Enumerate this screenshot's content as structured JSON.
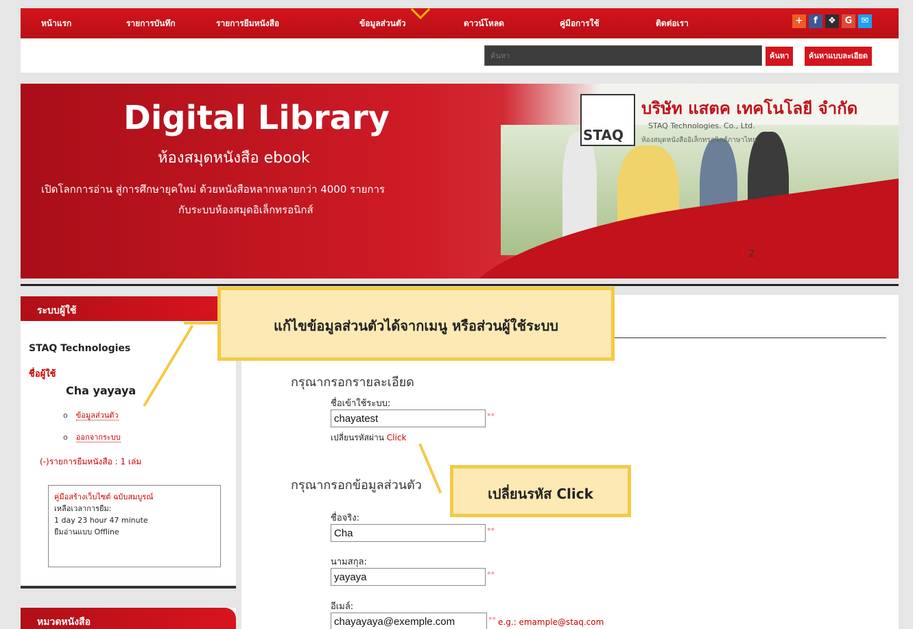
{
  "nav": {
    "items": [
      "หน้าแรก",
      "รายการบันทึก",
      "รายการยืมหนังสือ",
      "ข้อมูลส่วนตัว",
      "ดาวน์โหลด",
      "คู่มือการใช้",
      "ติดต่อเรา"
    ],
    "social_icons": [
      {
        "name": "plus-icon",
        "glyph": "+",
        "color": "#f05a28"
      },
      {
        "name": "facebook-icon",
        "glyph": "f",
        "color": "#3b5998"
      },
      {
        "name": "myspace-icon",
        "glyph": "❖",
        "color": "#2e2e2e"
      },
      {
        "name": "google-icon",
        "glyph": "G",
        "color": "#dd4b39"
      },
      {
        "name": "twitter-icon",
        "glyph": "✉",
        "color": "#1da1f2"
      }
    ]
  },
  "search": {
    "placeholder": "ค้นหา",
    "button": "ค้นหา",
    "advanced_button": "ค้นหาแบบละเอียด"
  },
  "banner": {
    "title": "Digital Library",
    "subtitle": "ห้องสมุดหนังสือ ebook",
    "line1": "เปิดโลกการอ่าน สู่การศึกษายุคใหม่ ด้วยหนังสือหลากหลายกว่า 4000 รายการ",
    "line2": "กับระบบห้องสมุดอิเล็กทรอนิกส์",
    "logo_text": "STAQ",
    "company_name": "บริษัท แสตค เทคโนโลยี จำกัด",
    "company_en": "STAQ Technologies. Co., Ltd.",
    "company_desc": "ห้องสมุดหนังสืออิเล็กทรอนิกส์ภาษาไทย",
    "slide_active": "1",
    "slide_other": "2"
  },
  "sidebar": {
    "user_panel_title": "ระบบผู้ใช้",
    "org": "STAQ Technologies",
    "user_label": "ชื่อผู้ใช้",
    "user_name": "Cha yayaya",
    "links": [
      "ข้อมูลส่วนตัว",
      "ออกจากระบบ"
    ],
    "borrow_count": "(-)รายการยืมหนังสือ : 1 เล่ม",
    "borrow_box": {
      "book": "คู่มือสร้างเว็บไซต์ ฉบับสมบูรณ์",
      "remaining_label": "เหลือเวลาการยืม:",
      "remaining": "1 day 23 hour 47 minute",
      "mode": "ยืมอ่านแบบ Offline"
    },
    "category_panel_title": "หมวดหนังสือ"
  },
  "form": {
    "section1": "กรุณากรอกรายละเอียด",
    "username_label": "ชื่อเข้าใช้ระบบ:",
    "username": "chayatest",
    "change_pw_text": "เปลี่ยนรหัสผ่าน",
    "change_pw_link": "Click",
    "section2": "กรุณากรอกข้อมูลส่วนตัว",
    "firstname_label": "ชื่อจริง:",
    "firstname": "Cha",
    "lastname_label": "นามสกุล:",
    "lastname": "yayaya",
    "email_label": "อีเมล์:",
    "email": "chayayaya@exemple.com",
    "required_mark": "**",
    "email_example": "e.g.: emample@staq.com"
  },
  "callouts": {
    "edit_info": "แก้ไขข้อมูลส่วนตัวได้จากเมนู หรือส่วนผู้ใช้ระบบ",
    "change_pw": "เปลี่ยนรหัส Click",
    "color": "#f5c946"
  },
  "colors": {
    "brand_red": "#d4141c"
  }
}
